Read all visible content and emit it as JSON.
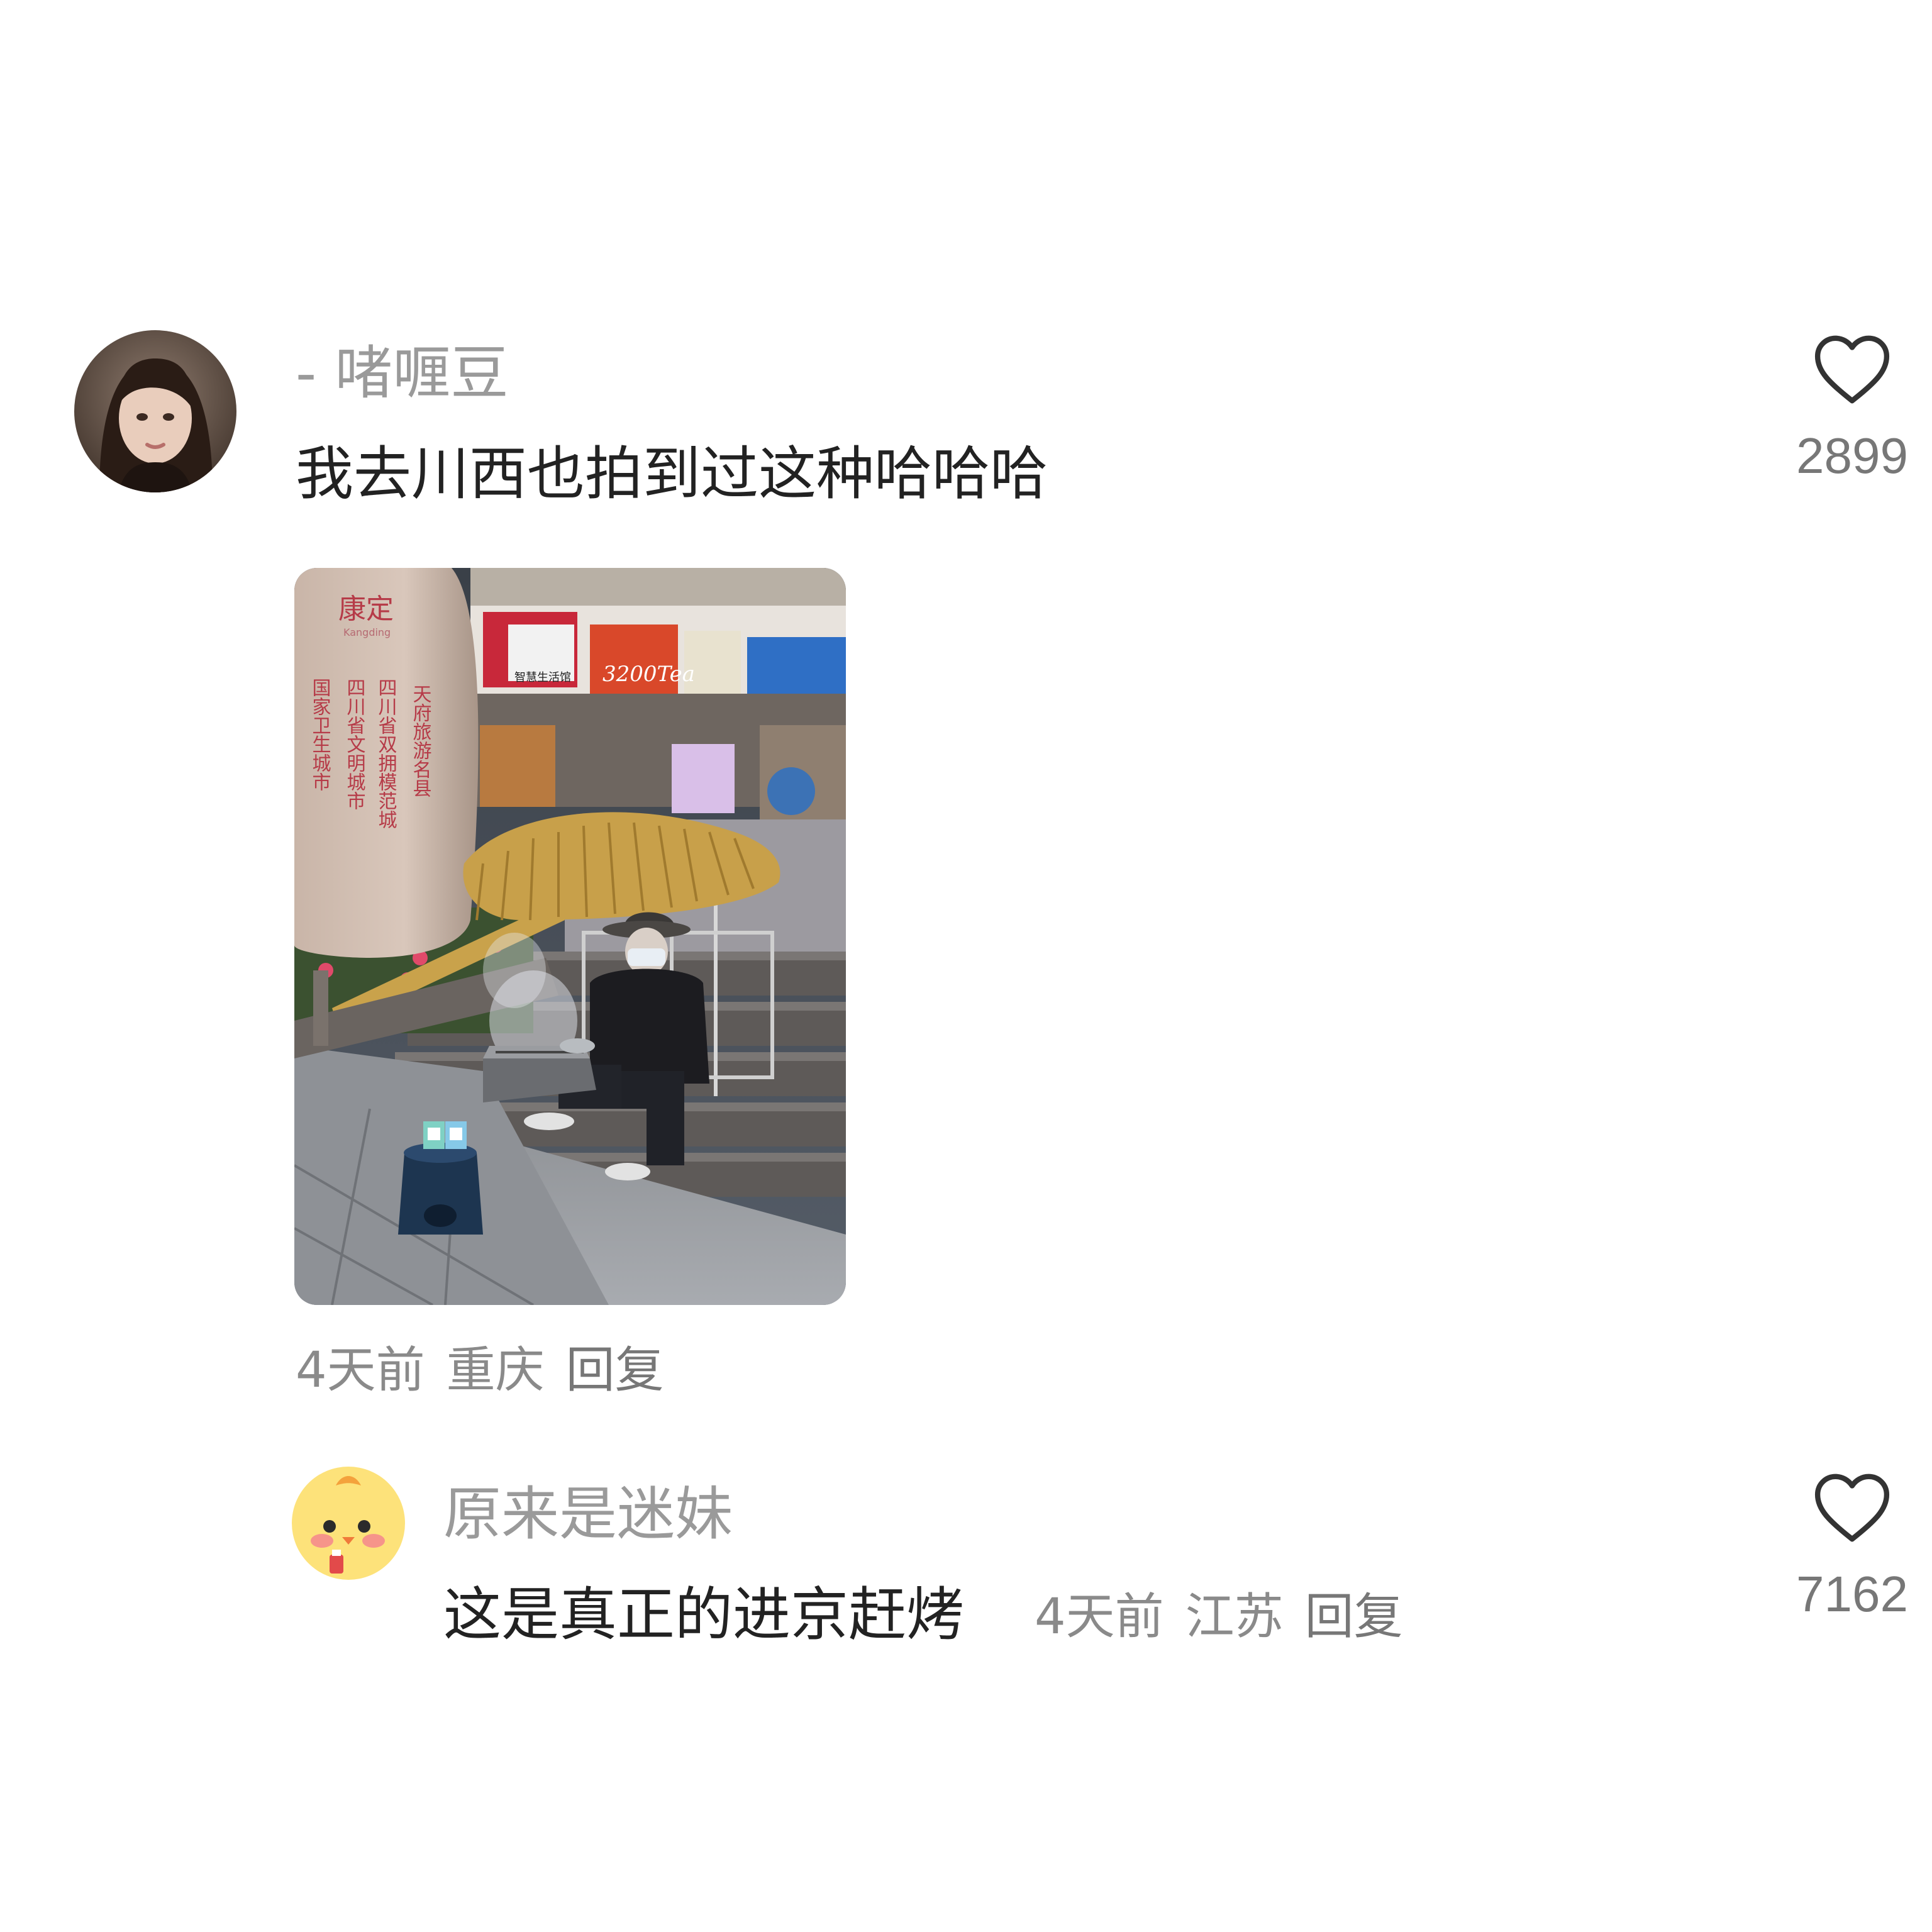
{
  "comments": [
    {
      "username": "- 啫喱豆",
      "text": "我去川西也拍到过这种哈哈哈",
      "time": "4天前",
      "location": "重庆",
      "reply_label": "回复",
      "like_count": "2899",
      "photo": {
        "stone_title": "康定",
        "stone_pinyin": "Kangding",
        "stone_col1": "天府旅游名县",
        "stone_col2": "四川省双拥模范城",
        "stone_col3": "四川省文明城市",
        "stone_col4": "国家卫生城市",
        "shop_sign": "3200Tea",
        "shop_sign2": "智慧生活馆"
      }
    },
    {
      "username": "原来是迷妹",
      "text": "这是真正的进京赶烤",
      "time": "4天前",
      "location": "江苏",
      "reply_label": "回复",
      "like_count": "7162"
    }
  ],
  "colors": {
    "username": "#9a9a9a",
    "text": "#222222",
    "meta": "#8a8a8a",
    "heart_stroke": "#333333"
  },
  "icons": [
    "heart-outline-icon"
  ]
}
